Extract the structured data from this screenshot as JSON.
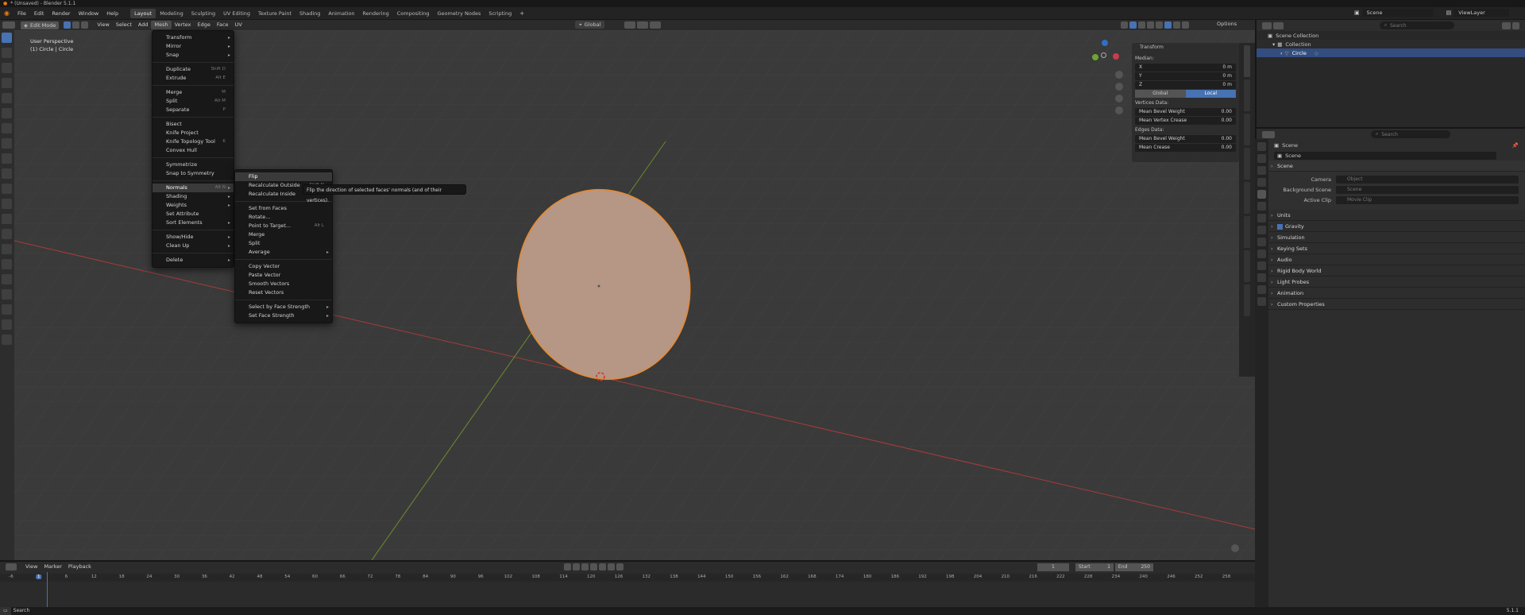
{
  "title": "* (Unsaved) - Blender 5.1.1",
  "menubar": [
    "File",
    "Edit",
    "Render",
    "Window",
    "Help"
  ],
  "workspaces": [
    {
      "label": "Layout",
      "active": true
    },
    {
      "label": "Modeling"
    },
    {
      "label": "Sculpting"
    },
    {
      "label": "UV Editing"
    },
    {
      "label": "Texture Paint"
    },
    {
      "label": "Shading"
    },
    {
      "label": "Animation"
    },
    {
      "label": "Rendering"
    },
    {
      "label": "Compositing"
    },
    {
      "label": "Geometry Nodes"
    },
    {
      "label": "Scripting"
    }
  ],
  "scene": {
    "label": "Scene",
    "viewlayer": "ViewLayer"
  },
  "header": {
    "mode": "Edit Mode",
    "menus": [
      "View",
      "Select",
      "Add",
      "Mesh",
      "Vertex",
      "Edge",
      "Face",
      "UV"
    ],
    "active_menu": "Mesh",
    "orientation": "Global",
    "options": "Options"
  },
  "viewport": {
    "line1": "User Perspective",
    "line2": "(1) Circle | Circle"
  },
  "npanel": {
    "title": "Transform",
    "median": "Median:",
    "fields": [
      {
        "k": "X",
        "v": "0 m"
      },
      {
        "k": "Y",
        "v": "0 m"
      },
      {
        "k": "Z",
        "v": "0 m"
      }
    ],
    "global": "Global",
    "local": "Local",
    "vertices": "Vertices Data:",
    "v1": "Mean Bevel Weight",
    "v1v": "0.00",
    "v2": "Mean Vertex Crease",
    "v2v": "0.00",
    "edges": "Edges Data:",
    "e1": "Mean Bevel Weight",
    "e1v": "0.00",
    "e2": "Mean Crease",
    "e2v": "0.00"
  },
  "mesh_menu": [
    {
      "label": "Transform",
      "sub": true
    },
    {
      "label": "Mirror",
      "sub": true
    },
    {
      "label": "Snap",
      "sub": true
    },
    {
      "sep": true
    },
    {
      "label": "Duplicate",
      "sc": "Shift D"
    },
    {
      "label": "Extrude",
      "sc": "Alt E"
    },
    {
      "sep": true
    },
    {
      "label": "Merge",
      "sc": "M"
    },
    {
      "label": "Split",
      "sc": "Alt M"
    },
    {
      "label": "Separate",
      "sc": "P"
    },
    {
      "sep": true
    },
    {
      "label": "Bisect"
    },
    {
      "label": "Knife Project"
    },
    {
      "label": "Knife Topology Tool",
      "sc": "K"
    },
    {
      "label": "Convex Hull"
    },
    {
      "sep": true
    },
    {
      "label": "Symmetrize"
    },
    {
      "label": "Snap to Symmetry"
    },
    {
      "sep": true
    },
    {
      "label": "Normals",
      "sc": "Alt N",
      "sub": true,
      "hl": true
    },
    {
      "label": "Shading",
      "sub": true
    },
    {
      "label": "Weights",
      "sub": true
    },
    {
      "label": "Set Attribute"
    },
    {
      "label": "Sort Elements",
      "sub": true
    },
    {
      "sep": true
    },
    {
      "label": "Show/Hide",
      "sub": true
    },
    {
      "label": "Clean Up",
      "sub": true
    },
    {
      "sep": true
    },
    {
      "label": "Delete",
      "sub": true
    }
  ],
  "normals_menu": [
    {
      "label": "Flip",
      "hl": true
    },
    {
      "label": "Recalculate Outside",
      "sc": "Shift N"
    },
    {
      "label": "Recalculate Inside"
    },
    {
      "sep": true
    },
    {
      "label": "Set from Faces"
    },
    {
      "label": "Rotate..."
    },
    {
      "label": "Point to Target...",
      "sc": "Alt L"
    },
    {
      "label": "Merge"
    },
    {
      "label": "Split"
    },
    {
      "label": "Average",
      "sub": true
    },
    {
      "sep": true
    },
    {
      "label": "Copy Vector"
    },
    {
      "label": "Paste Vector"
    },
    {
      "label": "Smooth Vectors"
    },
    {
      "label": "Reset Vectors"
    },
    {
      "sep": true
    },
    {
      "label": "Select by Face Strength",
      "sub": true
    },
    {
      "label": "Set Face Strength",
      "sub": true
    }
  ],
  "tooltip": "Flip the direction of selected faces' normals (and of their vertices).",
  "outliner": {
    "search": "Search",
    "root": "Scene Collection",
    "collection": "Collection",
    "object": "Circle"
  },
  "properties": {
    "search": "Search",
    "breadcrumb": "Scene",
    "name": "Scene",
    "panel": "Scene",
    "camera": "Camera",
    "camera_ph": "Object",
    "bg": "Background Scene",
    "bg_ph": "Scene",
    "clip": "Active Clip",
    "clip_ph": "Movie Clip",
    "sections": [
      "Units",
      "Gravity",
      "Simulation",
      "Keying Sets",
      "Audio",
      "Rigid Body World",
      "Light Probes",
      "Animation",
      "Custom Properties"
    ]
  },
  "timeline": {
    "menus": [
      "View",
      "Marker",
      "Playback"
    ],
    "current": "1",
    "start_label": "Start",
    "start": "1",
    "end_label": "End",
    "end": "250",
    "ticks": [
      "-6",
      "1",
      "6",
      "12",
      "18",
      "24",
      "30",
      "36",
      "42",
      "48",
      "54",
      "60",
      "66",
      "72",
      "78",
      "84",
      "90",
      "96",
      "102",
      "108",
      "114",
      "120",
      "126",
      "132",
      "138",
      "144",
      "150",
      "156",
      "162",
      "168",
      "174",
      "180",
      "186",
      "192",
      "198",
      "204",
      "210",
      "216",
      "222",
      "228",
      "234",
      "240",
      "246",
      "252",
      "258"
    ]
  },
  "status": {
    "left": "Search",
    "version": "5.1.1"
  },
  "colors": {
    "accent": "#4772b3",
    "circle_fill": "#b69685",
    "circle_edge": "#e58a2e",
    "x_axis": "#a83a3a",
    "y_axis": "#6a8a2c"
  }
}
